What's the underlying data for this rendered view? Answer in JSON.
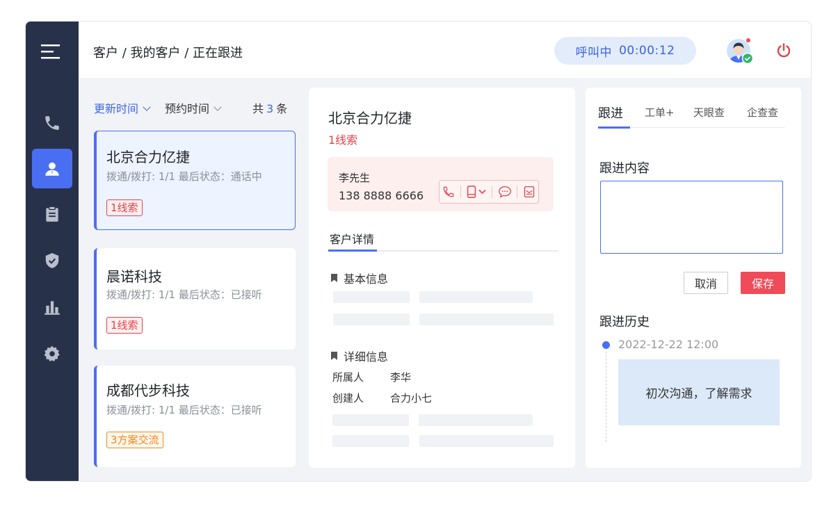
{
  "header": {
    "breadcrumb": "客户 / 我的客户 / 正在跟进",
    "call_status": "呼叫中",
    "call_timer": "00:00:12"
  },
  "sidebar": {
    "items": [
      {
        "name": "phone",
        "icon": "phone-icon"
      },
      {
        "name": "customers",
        "icon": "user-icon",
        "active": true
      },
      {
        "name": "tasks",
        "icon": "clipboard-icon"
      },
      {
        "name": "security",
        "icon": "shield-icon"
      },
      {
        "name": "reports",
        "icon": "bar-chart-icon"
      },
      {
        "name": "settings",
        "icon": "gear-icon"
      }
    ]
  },
  "list": {
    "sort_update": "更新时间",
    "sort_appointment": "预约时间",
    "total_prefix": "共",
    "total_count": "3",
    "total_suffix": "条",
    "cards": [
      {
        "name": "北京合力亿捷",
        "meta": "拨通/拨打:  1/1  最后状态：通话中",
        "tag": "1线索",
        "tag_color": "#e3424a"
      },
      {
        "name": "晨诺科技",
        "meta": "拨通/拨打:  1/1    最后状态：已接听",
        "tag": "1线索",
        "tag_color": "#e3424a"
      },
      {
        "name": "成都代步科技",
        "meta": "拨通/拨打:  1/1    最后状态：已接听",
        "tag": "3方案交流",
        "tag_color": "#f08a1f"
      }
    ]
  },
  "detail": {
    "title": "北京合力亿捷",
    "tag": "1线索",
    "contact_name": "李先生",
    "contact_phone": "138 8888 6666",
    "tab": "客户详情",
    "section_basic": "基本信息",
    "section_detail": "详细信息",
    "owner_label": "所属人",
    "owner_value": "李华",
    "creator_label": "创建人",
    "creator_value": "合力小七"
  },
  "followup": {
    "tabs": [
      "跟进",
      "工单+",
      "天眼查",
      "企查查"
    ],
    "content_label": "跟进内容",
    "cancel_label": "取消",
    "save_label": "保存",
    "history_label": "跟进历史",
    "history": [
      {
        "time": "2022-12-22 12:00",
        "text": "初次沟通，了解需求"
      }
    ]
  },
  "colors": {
    "sidebar_bg": "#27314a",
    "accent": "#4a6ef2",
    "danger": "#ef4b58"
  }
}
